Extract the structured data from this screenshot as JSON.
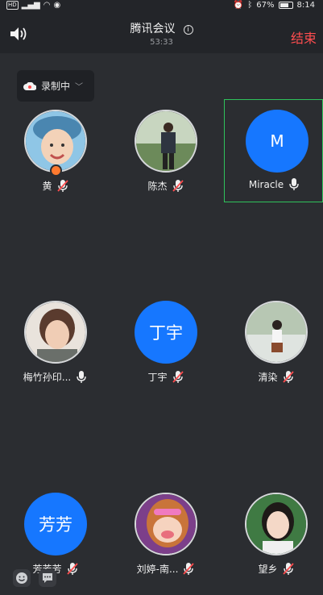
{
  "statusbar": {
    "left_badge": "HD",
    "battery": "67%",
    "time": "8:14"
  },
  "header": {
    "title": "腾讯会议",
    "timer": "53:33",
    "end_label": "结束"
  },
  "recording": {
    "label": "录制中"
  },
  "participants": [
    {
      "name": "黄",
      "avatar_type": "photo",
      "mic": "muted",
      "host": true
    },
    {
      "name": "陈杰",
      "avatar_type": "photo",
      "mic": "muted"
    },
    {
      "name": "Miracle",
      "avatar_type": "letter",
      "avatar_text": "M",
      "mic": "on",
      "active_speaker": true
    },
    {
      "name": "梅竹孙印...",
      "avatar_type": "photo",
      "mic": "on"
    },
    {
      "name": "丁宇",
      "avatar_type": "letter",
      "avatar_text": "丁宇",
      "mic": "muted"
    },
    {
      "name": "清染",
      "avatar_type": "photo",
      "mic": "muted"
    },
    {
      "name": "芳芳芳",
      "avatar_type": "letter",
      "avatar_text": "芳芳",
      "mic": "muted"
    },
    {
      "name": "刘婷-南...",
      "avatar_type": "photo",
      "mic": "muted"
    },
    {
      "name": "望乡",
      "avatar_type": "photo",
      "mic": "muted"
    }
  ],
  "colors": {
    "background": "#2b2d31",
    "accent_blue": "#1677ff",
    "end_red": "#ff4d4f",
    "active_border": "#2fc25b",
    "muted_red": "#ff4d4f"
  }
}
